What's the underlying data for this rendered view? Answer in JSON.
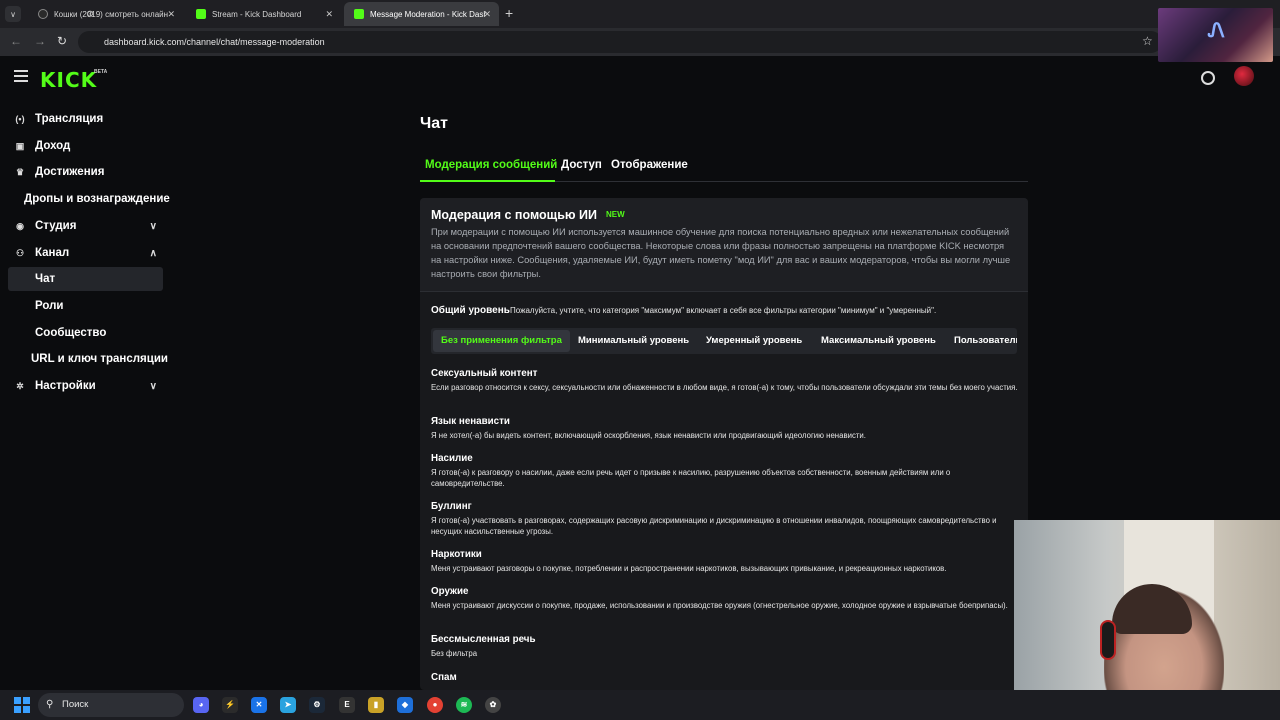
{
  "browser": {
    "tabs": [
      {
        "label": "Кошки (2019) смотреть онлайн",
        "active": false
      },
      {
        "label": "Stream - Kick Dashboard",
        "active": false
      },
      {
        "label": "Message Moderation - Kick Dashboard",
        "active": true
      }
    ],
    "url": "dashboard.kick.com/channel/chat/message-moderation",
    "close_glyph": "✕",
    "new_tab_glyph": "+"
  },
  "app": {
    "logo": "KICK",
    "logo_badge": "BETA"
  },
  "sidebar": {
    "items": [
      {
        "label": "Трансляция",
        "icon": "broadcast-icon",
        "glyph": "(•)"
      },
      {
        "label": "Доход",
        "icon": "revenue-icon",
        "glyph": "▣"
      },
      {
        "label": "Достижения",
        "icon": "trophy-icon",
        "glyph": "♛"
      },
      {
        "label": "Дропы и вознаграждение",
        "icon": "",
        "glyph": ""
      },
      {
        "label": "Студия",
        "icon": "studio-icon",
        "glyph": "◉",
        "chevron": "∨"
      },
      {
        "label": "Канал",
        "icon": "channel-icon",
        "glyph": "⚇",
        "chevron": "∧"
      },
      {
        "label": "Чат",
        "icon": "",
        "glyph": "",
        "active": true
      },
      {
        "label": "Роли",
        "icon": "",
        "glyph": ""
      },
      {
        "label": "Сообщество",
        "icon": "",
        "glyph": ""
      },
      {
        "label": "URL и ключ трансляции",
        "icon": "",
        "glyph": ""
      },
      {
        "label": "Настройки",
        "icon": "settings-icon",
        "glyph": "✲",
        "chevron": "∨"
      }
    ]
  },
  "main": {
    "title": "Чат",
    "tabs": [
      {
        "label": "Модерация сообщений",
        "active": true
      },
      {
        "label": "Доступ",
        "active": false
      },
      {
        "label": "Отображение",
        "active": false
      }
    ],
    "ai_moderation": {
      "title": "Модерация с помощью ИИ",
      "badge": "NEW",
      "description": "При модерации с помощью ИИ используется машинное обучение для поиска потенциально вредных или нежелательных сообщений на основании предпочтений вашего сообщества. Некоторые слова или фразы полностью запрещены на платформе KICK несмотря на настройки ниже. Сообщения, удаляемые ИИ, будут иметь пометку \"мод ИИ\" для вас и ваших модераторов, чтобы вы могли лучше настроить свои фильтры."
    },
    "general_level": {
      "title": "Общий уровень",
      "note": "Пожалуйста, учтите, что категория \"максимум\" включает в себя все фильтры категории \"минимум\" и \"умеренный\"."
    },
    "filter_levels": [
      {
        "label": "Без применения фильтра",
        "active": true
      },
      {
        "label": "Минимальный уровень",
        "active": false
      },
      {
        "label": "Умеренный уровень",
        "active": false
      },
      {
        "label": "Максимальный уровень",
        "active": false
      },
      {
        "label": "Пользовательский",
        "active": false
      }
    ],
    "categories": [
      {
        "title": "Сексуальный контент",
        "desc": "Если разговор относится к сексу, сексуальности или обнаженности в любом виде, я готов(-а) к тому, чтобы пользователи обсуждали эти темы без моего участия."
      },
      {
        "title": "Язык ненависти",
        "desc": "Я не хотел(-а) бы видеть контент, включающий оскорбления, язык ненависти или продвигающий идеологию ненависти."
      },
      {
        "title": "Насилие",
        "desc": "Я готов(-а) к разговору о насилии, даже если речь идет о призыве к насилию, разрушению объектов собственности, военным действиям или о самовредительстве."
      },
      {
        "title": "Буллинг",
        "desc": "Я готов(-а) участвовать в разговорах, содержащих расовую дискриминацию и дискриминацию в отношении инвалидов, поощряющих самовредительство и несущих насильственные угрозы."
      },
      {
        "title": "Наркотики",
        "desc": "Меня устраивают разговоры о покупке, потреблении и распространении наркотиков, вызывающих привыкание, и рекреационных наркотиков."
      },
      {
        "title": "Оружие",
        "desc": "Меня устраивают дискуссии о покупке, продаже, использовании и производстве оружия (огнестрельное оружие, холодное оружие и взрывчатые боеприпасы)."
      },
      {
        "title": "Бессмысленная речь",
        "desc": "Без фильтра"
      },
      {
        "title": "Спам",
        "desc": ""
      }
    ]
  },
  "taskbar": {
    "search_label": "Поиск",
    "icons": [
      {
        "name": "discord-icon",
        "glyph": "◕",
        "color": "#5865f2"
      },
      {
        "name": "app-icon",
        "glyph": "⚡",
        "color": "#2b2b2b"
      },
      {
        "name": "xbox-app-icon",
        "glyph": "✕",
        "color": "#1a73e8"
      },
      {
        "name": "telegram-icon",
        "glyph": "➤",
        "color": "#2aa3df"
      },
      {
        "name": "steam-icon",
        "glyph": "⚙",
        "color": "#1b2838"
      },
      {
        "name": "epic-games-icon",
        "glyph": "E",
        "color": "#333"
      },
      {
        "name": "file-icon",
        "glyph": "▮",
        "color": "#c9a227"
      },
      {
        "name": "app2-icon",
        "glyph": "◆",
        "color": "#1e6fd9"
      },
      {
        "name": "chrome-icon",
        "glyph": "●",
        "color": "#e34133"
      },
      {
        "name": "spotify-icon",
        "glyph": "≋",
        "color": "#1db954"
      },
      {
        "name": "app3-icon",
        "glyph": "✿",
        "color": "#444"
      }
    ]
  },
  "colors": {
    "accent": "#53fc18",
    "background": "#0b0c0e",
    "panel": "#18191c"
  }
}
